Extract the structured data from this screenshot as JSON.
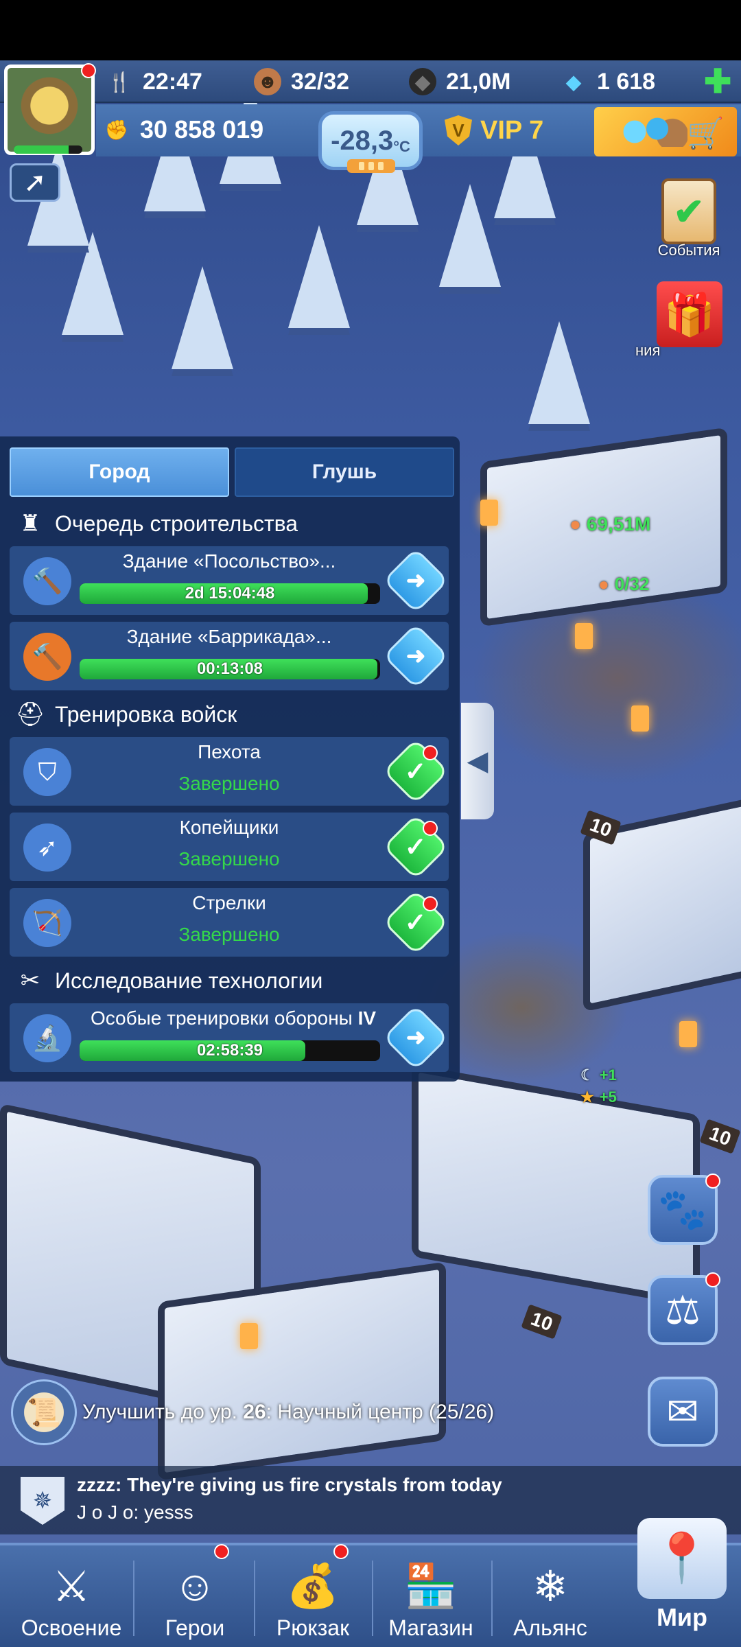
{
  "resources": {
    "food": "22:47",
    "population": "32/32",
    "coal": "21,0M",
    "gems": "1 618",
    "power": "30 858 019",
    "temperature": "-28,3",
    "temperature_unit": "°C",
    "vip": "VIP 7"
  },
  "side": {
    "events_label": "События",
    "gift_label": "ния"
  },
  "panel": {
    "tabs": [
      "Город",
      "Глушь"
    ],
    "construction_title": "Очередь строительства",
    "construction": [
      {
        "title": "Здание «Посольство»...",
        "timer": "2d 15:04:48",
        "progress": 0.96
      },
      {
        "title": "Здание «Баррикада»...",
        "timer": "00:13:08",
        "progress": 0.99
      }
    ],
    "training_title": "Тренировка войск",
    "training": [
      {
        "title": "Пехота",
        "status": "Завершено"
      },
      {
        "title": "Копейщики",
        "status": "Завершено"
      },
      {
        "title": "Стрелки",
        "status": "Завершено"
      }
    ],
    "research_title": "Исследование технологии",
    "research": [
      {
        "title_prefix": "Особые тренировки обороны ",
        "title_level": "IV",
        "timer": "02:58:39",
        "progress": 0.75
      }
    ]
  },
  "map": {
    "food_amount": "69,51M",
    "people_amount": "0/32",
    "level_signs": [
      "10",
      "10",
      "10"
    ],
    "bonus_1": "+1",
    "bonus_2": "+5"
  },
  "quest": {
    "prefix": "Улучшить до ур. ",
    "level": "26",
    "middle": ": Научный центр ",
    "count": "(25/26)"
  },
  "chat": {
    "line1": "zzzz: They're giving us fire crystals from today",
    "line2": "J o J o: yesss"
  },
  "nav": [
    "Освоение",
    "Герои",
    "Рюкзак",
    "Магазин",
    "Альянс",
    "Мир"
  ]
}
